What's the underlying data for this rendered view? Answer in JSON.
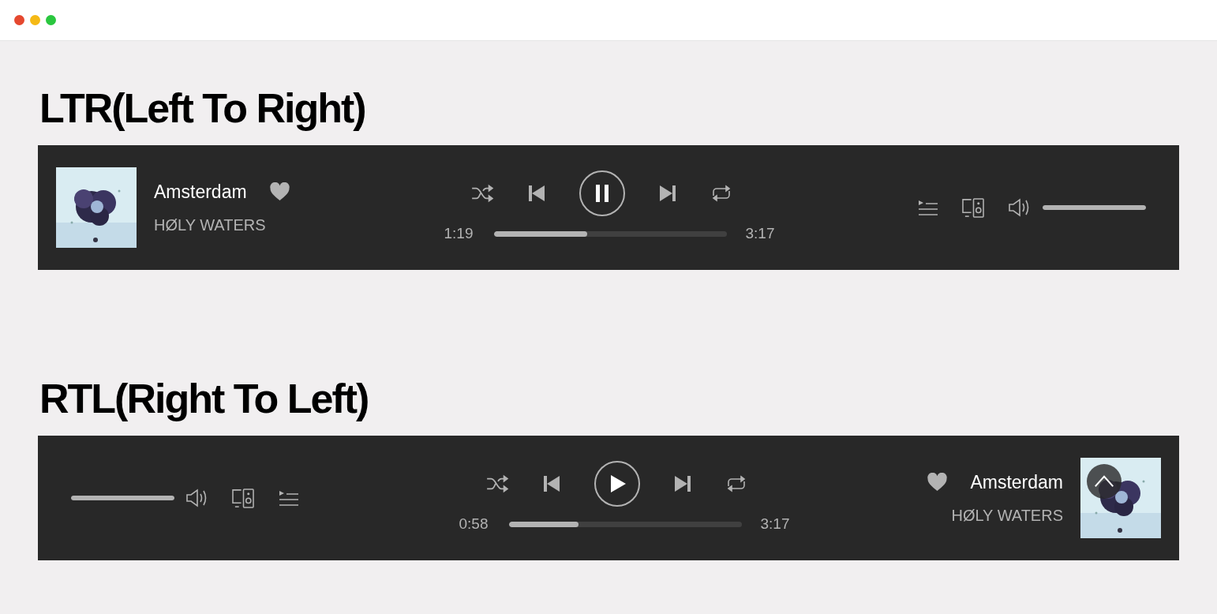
{
  "sections": [
    {
      "heading": "LTR(Left To Right)",
      "kind": "ltr",
      "player": {
        "title": "Amsterdam",
        "artist": "HØLY WATERS",
        "playing": true,
        "expand_button": false,
        "elapsed": "1:19",
        "duration": "3:17",
        "progress": {
          "level": 0.4
        },
        "volume": {
          "level": 1
        }
      }
    },
    {
      "heading": "RTL(Right To Left)",
      "kind": "rtl",
      "player": {
        "title": "Amsterdam",
        "artist": "HØLY WATERS",
        "playing": false,
        "expand_button": true,
        "elapsed": "0:58",
        "duration": "3:17",
        "progress": {
          "level": 0.3
        },
        "volume": {
          "level": 1
        }
      }
    }
  ]
}
